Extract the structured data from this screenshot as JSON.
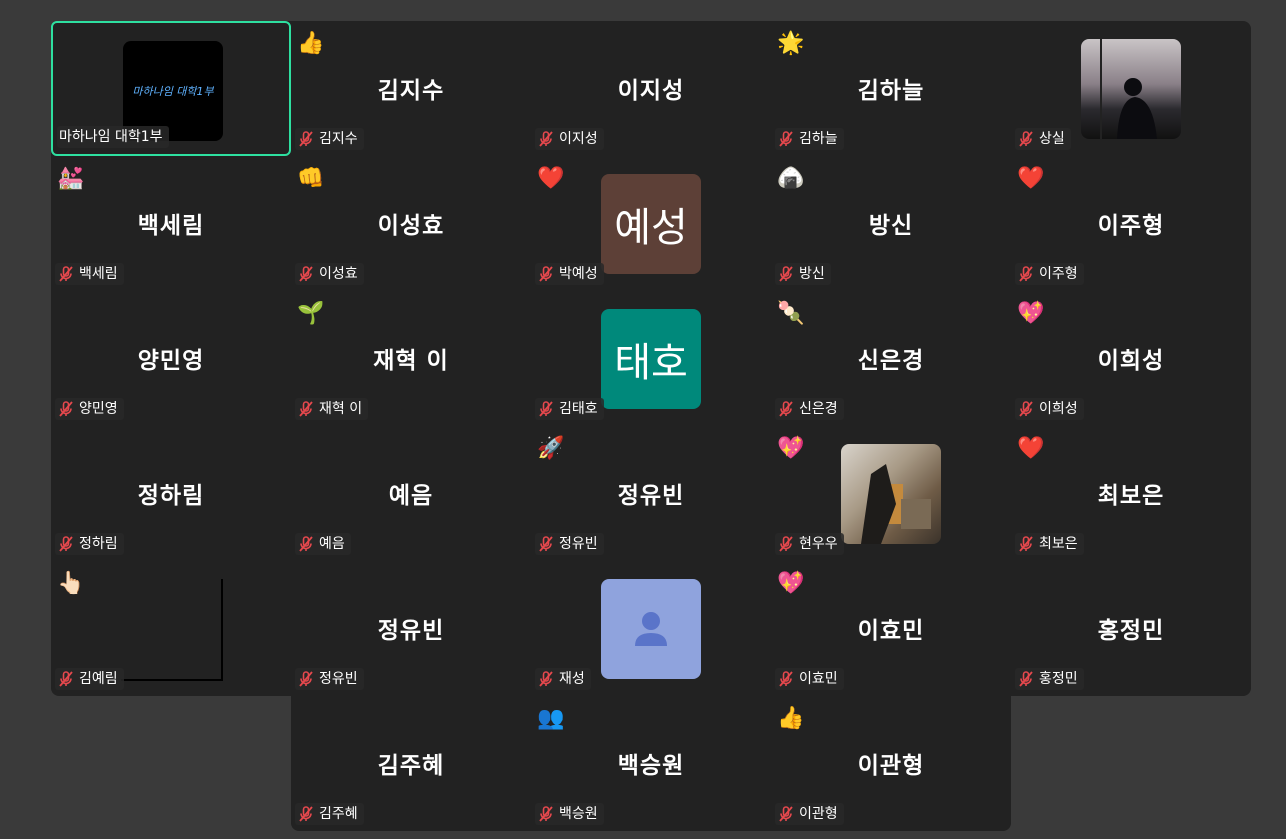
{
  "tiles": [
    {
      "id": "t0",
      "name": "",
      "label": "마하나임 대학1부",
      "emoji": "",
      "avatar": "logo",
      "active": true,
      "logo_text": "마하나임 대학1부"
    },
    {
      "id": "t1",
      "name": "김지수",
      "label": "김지수",
      "emoji": "👍"
    },
    {
      "id": "t2",
      "name": "이지성",
      "label": "이지성",
      "emoji": ""
    },
    {
      "id": "t3",
      "name": "김하늘",
      "label": "김하늘",
      "emoji": "🌟"
    },
    {
      "id": "t4",
      "name": "",
      "label": "상실",
      "emoji": "",
      "avatar": "photo-dark"
    },
    {
      "id": "t5",
      "name": "백세림",
      "label": "백세림",
      "emoji": "💒"
    },
    {
      "id": "t6",
      "name": "이성효",
      "label": "이성효",
      "emoji": "👊"
    },
    {
      "id": "t7",
      "name": "",
      "label": "박예성",
      "emoji": "❤️",
      "avatar": "text",
      "avatar_text": "예성",
      "avatar_color": "#5d4037"
    },
    {
      "id": "t8",
      "name": "방신",
      "label": "방신",
      "emoji": "🍙"
    },
    {
      "id": "t9",
      "name": "이주형",
      "label": "이주형",
      "emoji": "❤️"
    },
    {
      "id": "t10",
      "name": "양민영",
      "label": "양민영",
      "emoji": ""
    },
    {
      "id": "t11",
      "name": "재혁 이",
      "label": "재혁 이",
      "emoji": "🌱"
    },
    {
      "id": "t12",
      "name": "",
      "label": "김태호",
      "emoji": "",
      "avatar": "text",
      "avatar_text": "태호",
      "avatar_color": "#00897b"
    },
    {
      "id": "t13",
      "name": "신은경",
      "label": "신은경",
      "emoji": "🍡"
    },
    {
      "id": "t14",
      "name": "이희성",
      "label": "이희성",
      "emoji": "💖"
    },
    {
      "id": "t15",
      "name": "정하림",
      "label": "정하림",
      "emoji": ""
    },
    {
      "id": "t16",
      "name": "예음",
      "label": "예음",
      "emoji": ""
    },
    {
      "id": "t17",
      "name": "정유빈",
      "label": "정유빈",
      "emoji": "🚀"
    },
    {
      "id": "t18",
      "name": "",
      "label": "현우우",
      "emoji": "💖",
      "avatar": "photo-light"
    },
    {
      "id": "t19",
      "name": "최보은",
      "label": "최보은",
      "emoji": "❤️"
    },
    {
      "id": "t20",
      "name": "",
      "label": "김예림",
      "emoji": "👆🏻",
      "avatar": "frame"
    },
    {
      "id": "t21",
      "name": "정유빈",
      "label": "정유빈",
      "emoji": ""
    },
    {
      "id": "t22",
      "name": "",
      "label": "재성",
      "emoji": "",
      "avatar": "person",
      "avatar_color": "#8fa3dd"
    },
    {
      "id": "t23",
      "name": "이효민",
      "label": "이효민",
      "emoji": "💖"
    },
    {
      "id": "t24",
      "name": "홍정민",
      "label": "홍정민",
      "emoji": ""
    }
  ],
  "extra_tiles": [
    {
      "id": "e0",
      "name": "김주혜",
      "label": "김주혜",
      "emoji": ""
    },
    {
      "id": "e1",
      "name": "백승원",
      "label": "백승원",
      "emoji": "👥"
    },
    {
      "id": "e2",
      "name": "이관형",
      "label": "이관형",
      "emoji": "👍"
    }
  ],
  "colors": {
    "active_border": "#2ee0a0",
    "tile_bg": "#222222",
    "mute": "#e5484d"
  }
}
